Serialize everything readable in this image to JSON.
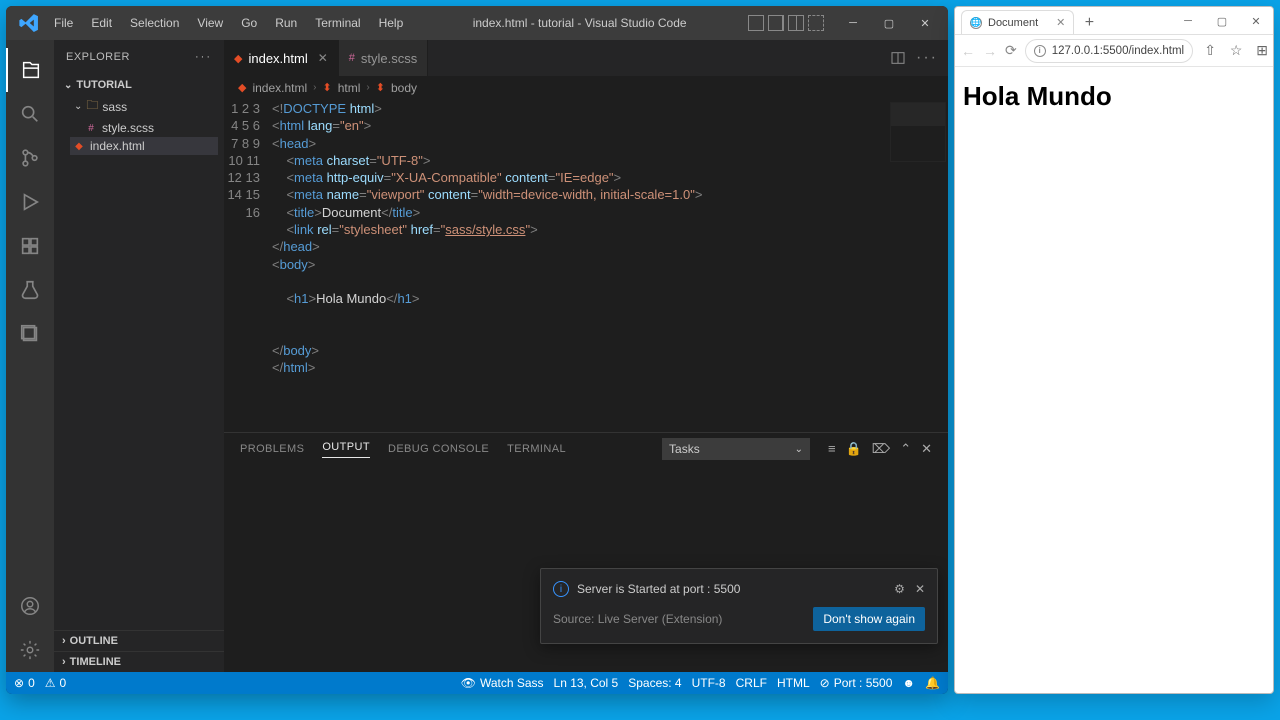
{
  "vscode": {
    "menu": [
      "File",
      "Edit",
      "Selection",
      "View",
      "Go",
      "Run",
      "Terminal",
      "Help"
    ],
    "windowTitle": "index.html - tutorial - Visual Studio Code",
    "explorer": {
      "title": "EXPLORER",
      "project": "TUTORIAL",
      "folder": "sass",
      "files": [
        "style.scss",
        "index.html"
      ],
      "outline": "OUTLINE",
      "timeline": "TIMELINE"
    },
    "tabs": [
      {
        "name": "index.html",
        "active": true
      },
      {
        "name": "style.scss",
        "active": false
      }
    ],
    "breadcrumbs": [
      "index.html",
      "html",
      "body"
    ],
    "lineCount": 16,
    "panel": {
      "tabs": [
        "PROBLEMS",
        "OUTPUT",
        "DEBUG CONSOLE",
        "TERMINAL"
      ],
      "active": "OUTPUT",
      "taskSelect": "Tasks"
    },
    "toast": {
      "msg": "Server is Started at port : 5500",
      "source": "Source: Live Server (Extension)",
      "button": "Don't show again"
    },
    "status": {
      "errors": "0",
      "warnings": "0",
      "watchSass": "Watch Sass",
      "pos": "Ln 13, Col 5",
      "spaces": "Spaces: 4",
      "encoding": "UTF-8",
      "eol": "CRLF",
      "lang": "HTML",
      "port": "Port : 5500"
    }
  },
  "browser": {
    "tabTitle": "Document",
    "url": "127.0.0.1:5500/index.html",
    "heading": "Hola Mundo"
  }
}
